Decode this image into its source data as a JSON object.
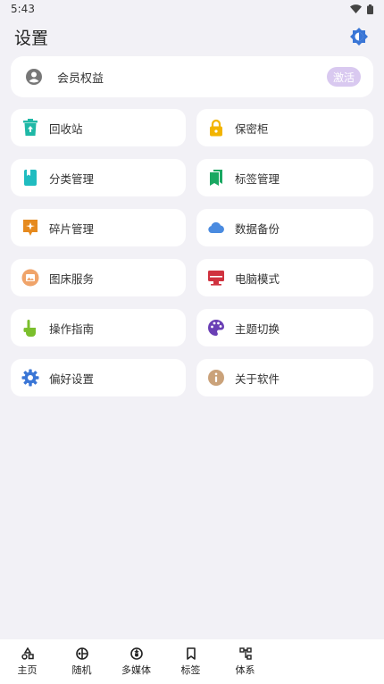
{
  "status": {
    "time": "5:43"
  },
  "header": {
    "title": "设置"
  },
  "member": {
    "label": "会员权益",
    "action": "激活"
  },
  "grid": [
    {
      "label": "回收站",
      "icon": "trash-icon"
    },
    {
      "label": "保密柜",
      "icon": "lock-icon"
    },
    {
      "label": "分类管理",
      "icon": "book-icon"
    },
    {
      "label": "标签管理",
      "icon": "bookmarks-icon"
    },
    {
      "label": "碎片管理",
      "icon": "sparkle-icon"
    },
    {
      "label": "数据备份",
      "icon": "cloud-icon"
    },
    {
      "label": "图床服务",
      "icon": "image-icon"
    },
    {
      "label": "电脑模式",
      "icon": "monitor-icon"
    },
    {
      "label": "操作指南",
      "icon": "pointer-icon"
    },
    {
      "label": "主题切换",
      "icon": "palette-icon"
    },
    {
      "label": "偏好设置",
      "icon": "gear-icon"
    },
    {
      "label": "关于软件",
      "icon": "info-icon"
    }
  ],
  "nav": [
    {
      "label": "主页",
      "icon": "shapes-icon"
    },
    {
      "label": "随机",
      "icon": "dice-icon"
    },
    {
      "label": "多媒体",
      "icon": "aperture-icon"
    },
    {
      "label": "标签",
      "icon": "bookmark-icon"
    },
    {
      "label": "体系",
      "icon": "hierarchy-icon"
    }
  ],
  "colors": {
    "background": "#f2f1f6",
    "accent_blue": "#3a76d6",
    "activate_badge": "#d9c9f0"
  }
}
